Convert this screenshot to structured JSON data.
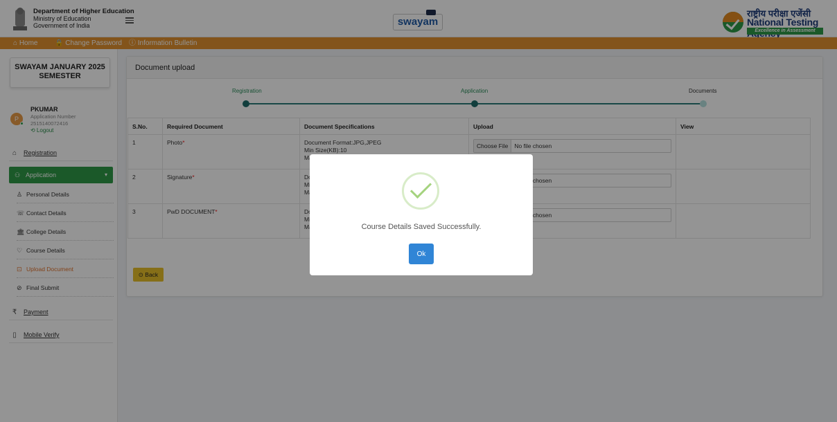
{
  "header": {
    "dept_title": "Department of Higher Education",
    "dept_line2": "Ministry of Education",
    "dept_line3": "Government of India",
    "swayam_logo": "swayam",
    "nta_hindi": "राष्ट्रीय परीक्षा एजेंसी",
    "nta_english": "National Testing Agency",
    "nta_tagline": "Excellence in Assessment"
  },
  "navbar": {
    "home": "⌂ Home",
    "change_password": "🔒 Change Password",
    "info_bulletin": "ⓘ Information Bulletin"
  },
  "sidebar": {
    "semester_line1": "SWAYAM JANUARY 2025",
    "semester_line2": "SEMESTER",
    "avatar_letter": "P",
    "user_name": "PKUMAR",
    "app_number_label": "Application Number",
    "app_number": "2515140072416",
    "logout": "⟲ Logout",
    "registration": "Registration",
    "application": "Application",
    "sub_items": [
      {
        "icon": "♙",
        "label": "Personal Details"
      },
      {
        "icon": "☏",
        "label": "Contact Details"
      },
      {
        "icon": "🏛",
        "label": "College Details"
      },
      {
        "icon": "♡",
        "label": "Course Details"
      },
      {
        "icon": "⊡",
        "label": "Upload Document"
      },
      {
        "icon": "⊘",
        "label": "Final Submit"
      }
    ],
    "payment": "Payment",
    "mobile_verify": "Mobile Verify"
  },
  "main": {
    "title": "Document upload",
    "steps": [
      "Registration",
      "Application",
      "Documents"
    ],
    "table": {
      "headers": [
        "S.No.",
        "Required Document",
        "Document Specifications",
        "Upload",
        "View"
      ],
      "rows": [
        {
          "sno": "1",
          "doc": "Photo",
          "spec1": "Document Format:JPG,JPEG",
          "spec2": "Min Size(KB):10",
          "spec3": "Ma"
        },
        {
          "sno": "2",
          "doc": "Signature",
          "spec1": "Do",
          "spec2": "Mi",
          "spec3": "Ma"
        },
        {
          "sno": "3",
          "doc": "PwD DOCUMENT",
          "spec1": "Do",
          "spec2": "Mi",
          "spec3": "Ma"
        }
      ],
      "choose_file": "Choose File",
      "no_file": "No file chosen",
      "no_file_partial": "chosen"
    },
    "back_button": "⊙ Back"
  },
  "modal": {
    "message": "Course Details Saved Successfully.",
    "ok_label": "Ok"
  },
  "colors": {
    "accent_orange": "#e2922f",
    "active_green": "#2f9a47",
    "ok_blue": "#3085d6",
    "back_yellow": "#e7c02a"
  }
}
